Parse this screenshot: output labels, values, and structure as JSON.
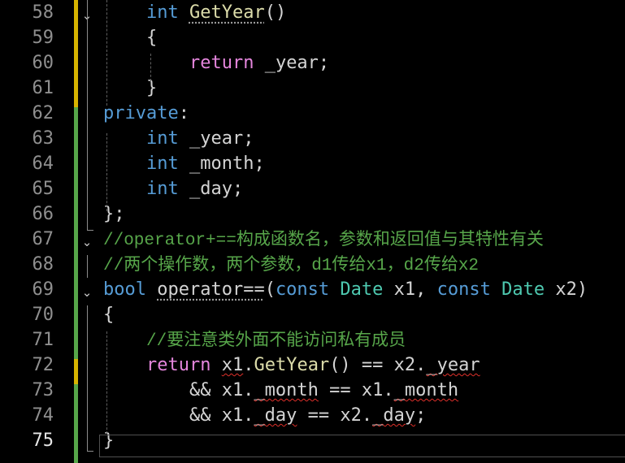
{
  "editor": {
    "lines": [
      {
        "num": "58",
        "tokens": [
          {
            "t": "    "
          },
          {
            "t": "int",
            "c": "kw"
          },
          {
            "t": " "
          },
          {
            "t": "GetYear",
            "c": "fn",
            "u": "hint"
          },
          {
            "t": "()",
            "c": "pl"
          }
        ]
      },
      {
        "num": "59",
        "tokens": [
          {
            "t": "    {",
            "c": "pl"
          }
        ]
      },
      {
        "num": "60",
        "tokens": [
          {
            "t": "        "
          },
          {
            "t": "return",
            "c": "ct"
          },
          {
            "t": " _year;",
            "c": "pl"
          }
        ]
      },
      {
        "num": "61",
        "tokens": [
          {
            "t": "    }",
            "c": "pl"
          }
        ]
      },
      {
        "num": "62",
        "tokens": [
          {
            "t": "private",
            "c": "kw"
          },
          {
            "t": ":",
            "c": "pl"
          }
        ]
      },
      {
        "num": "63",
        "tokens": [
          {
            "t": "    "
          },
          {
            "t": "int",
            "c": "kw"
          },
          {
            "t": " _year;",
            "c": "pl"
          }
        ]
      },
      {
        "num": "64",
        "tokens": [
          {
            "t": "    "
          },
          {
            "t": "int",
            "c": "kw"
          },
          {
            "t": " _month;",
            "c": "pl"
          }
        ]
      },
      {
        "num": "65",
        "tokens": [
          {
            "t": "    "
          },
          {
            "t": "int",
            "c": "kw"
          },
          {
            "t": " _day;",
            "c": "pl"
          }
        ]
      },
      {
        "num": "66",
        "tokens": [
          {
            "t": "};",
            "c": "pl"
          }
        ]
      },
      {
        "num": "67",
        "tokens": [
          {
            "t": "//operator+==构成函数名，参数和返回值与其特性有关",
            "c": "cm",
            "font": "cmt"
          }
        ]
      },
      {
        "num": "68",
        "tokens": [
          {
            "t": "//两个操作数，两个参数，d1传给x1，d2传给x2",
            "c": "cm",
            "font": "cmt"
          }
        ]
      },
      {
        "num": "69",
        "tokens": [
          {
            "t": "bool",
            "c": "kw"
          },
          {
            "t": " "
          },
          {
            "t": "operator==",
            "c": "pl",
            "u": "hint"
          },
          {
            "t": "(",
            "c": "pl"
          },
          {
            "t": "const",
            "c": "kw"
          },
          {
            "t": " "
          },
          {
            "t": "Date",
            "c": "ty"
          },
          {
            "t": " x1, ",
            "c": "pl"
          },
          {
            "t": "const",
            "c": "kw"
          },
          {
            "t": " "
          },
          {
            "t": "Date",
            "c": "ty"
          },
          {
            "t": " x2)",
            "c": "pl"
          }
        ]
      },
      {
        "num": "70",
        "tokens": [
          {
            "t": "{",
            "c": "pl"
          }
        ]
      },
      {
        "num": "71",
        "tokens": [
          {
            "t": "    "
          },
          {
            "t": "//要注意类外面不能访问私有成员",
            "c": "cm",
            "font": "cmt"
          }
        ]
      },
      {
        "num": "72",
        "tokens": [
          {
            "t": "    "
          },
          {
            "t": "return",
            "c": "ct"
          },
          {
            "t": " "
          },
          {
            "t": "x1",
            "c": "pl",
            "u": "bad"
          },
          {
            "t": ".",
            "c": "pl"
          },
          {
            "t": "GetYear",
            "c": "fn"
          },
          {
            "t": "() == x2.",
            "c": "pl"
          },
          {
            "t": "_year",
            "c": "pl",
            "u": "bad"
          }
        ]
      },
      {
        "num": "73",
        "tokens": [
          {
            "t": "        && x1.",
            "c": "pl"
          },
          {
            "t": "_month",
            "c": "pl",
            "u": "bad"
          },
          {
            "t": " == x1.",
            "c": "pl"
          },
          {
            "t": "_month",
            "c": "pl",
            "u": "bad"
          }
        ]
      },
      {
        "num": "74",
        "tokens": [
          {
            "t": "        && x1.",
            "c": "pl"
          },
          {
            "t": "_day",
            "c": "pl",
            "u": "bad"
          },
          {
            "t": " == x2.",
            "c": "pl"
          },
          {
            "t": "_day",
            "c": "pl",
            "u": "bad"
          },
          {
            "t": ";",
            "c": "pl"
          }
        ]
      },
      {
        "num": "75",
        "tokens": [
          {
            "t": "}",
            "c": "pl"
          }
        ]
      }
    ],
    "current_line": "75",
    "fold_glyph": "⌄",
    "colors": {
      "background": "#000000",
      "keyword": "#569cd6",
      "type": "#4ec9b0",
      "function": "#dcdcaa",
      "control": "#e586dd",
      "comment": "#57a64a",
      "plain": "#d4d4d4",
      "line_number": "#8f8f8f",
      "saved_change": "#57a64a",
      "unsaved_change": "#d7b400",
      "error_squiggle": "#e0302a"
    }
  }
}
